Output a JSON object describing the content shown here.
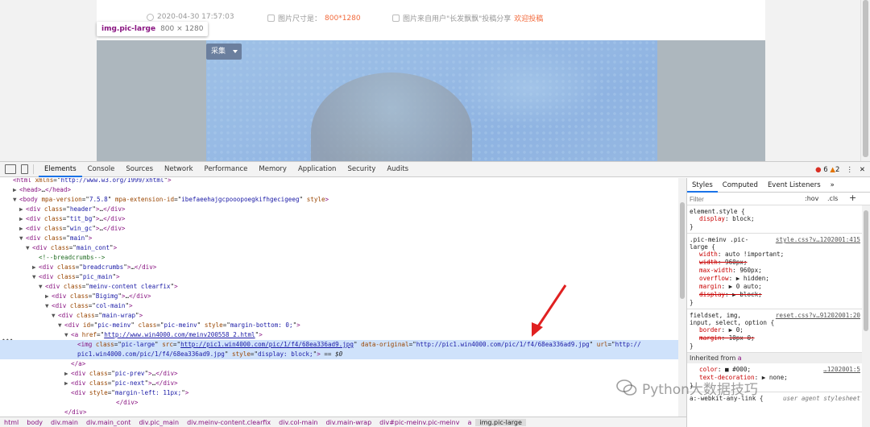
{
  "viewport": {
    "date": "2020-04-30 17:57:03",
    "size_label": "图片尺寸是：",
    "size_value": "800*1280",
    "share_text": "图片来自用户\"长发飘飘\"投稿分享",
    "submit_link": "欢迎投稿",
    "collect_button": "采集",
    "tooltip_tag": "img.pic-large",
    "tooltip_size": "800 × 1280"
  },
  "devtools": {
    "tabs": [
      "Elements",
      "Console",
      "Sources",
      "Network",
      "Performance",
      "Memory",
      "Application",
      "Security",
      "Audits"
    ],
    "active_tab": "Elements",
    "error_count": "6",
    "warning_count": "2",
    "more_tabs": "»",
    "menu": "⋮",
    "close": "✕"
  },
  "dom": [
    {
      "indent": 0,
      "tri": "",
      "html": "<span class='tag'>&lt;html</span> <span class='attr'>xmlns</span>=\"<span class='val'>http://www.w3.org/1999/xhtml</span>\"<span class='tag'>&gt;</span>"
    },
    {
      "indent": 1,
      "tri": "▶",
      "html": "<span class='tag'>&lt;head&gt;</span>…<span class='tag'>&lt;/head&gt;</span>"
    },
    {
      "indent": 1,
      "tri": "▼",
      "html": "<span class='tag'>&lt;body</span> <span class='attr'>mpa-version</span>=\"<span class='val'>7.5.8</span>\" <span class='attr'>mpa-extension-id</span>=\"<span class='val'>ibefaeehajgcpooopoegkifhgecigeeg</span>\" <span class='attr'>style</span><span class='tag'>&gt;</span>"
    },
    {
      "indent": 2,
      "tri": "▶",
      "html": "<span class='tag'>&lt;div</span> <span class='attr'>class</span>=\"<span class='val'>header</span>\"<span class='tag'>&gt;</span>…<span class='tag'>&lt;/div&gt;</span>"
    },
    {
      "indent": 2,
      "tri": "▶",
      "html": "<span class='tag'>&lt;div</span> <span class='attr'>class</span>=\"<span class='val'>tit_bg</span>\"<span class='tag'>&gt;</span>…<span class='tag'>&lt;/div&gt;</span>"
    },
    {
      "indent": 2,
      "tri": "▶",
      "html": "<span class='tag'>&lt;div</span> <span class='attr'>class</span>=\"<span class='val'>win_gc</span>\"<span class='tag'>&gt;</span>…<span class='tag'>&lt;/div&gt;</span>"
    },
    {
      "indent": 2,
      "tri": "▼",
      "html": "<span class='tag'>&lt;div</span> <span class='attr'>class</span>=\"<span class='val'>main</span>\"<span class='tag'>&gt;</span>"
    },
    {
      "indent": 3,
      "tri": "▼",
      "html": "<span class='tag'>&lt;div</span> <span class='attr'>class</span>=\"<span class='val'>main_cont</span>\"<span class='tag'>&gt;</span>"
    },
    {
      "indent": 4,
      "tri": "",
      "html": "<span class='cmt'>&lt;!--breadcrumbs--&gt;</span>"
    },
    {
      "indent": 4,
      "tri": "▶",
      "html": "<span class='tag'>&lt;div</span> <span class='attr'>class</span>=\"<span class='val'>breadcrumbs</span>\"<span class='tag'>&gt;</span>…<span class='tag'>&lt;/div&gt;</span>"
    },
    {
      "indent": 4,
      "tri": "▼",
      "html": "<span class='tag'>&lt;div</span> <span class='attr'>class</span>=\"<span class='val'>pic_main</span>\"<span class='tag'>&gt;</span>"
    },
    {
      "indent": 5,
      "tri": "▼",
      "html": "<span class='tag'>&lt;div</span> <span class='attr'>class</span>=\"<span class='val'>meinv-content clearfix</span>\"<span class='tag'>&gt;</span>"
    },
    {
      "indent": 6,
      "tri": "▶",
      "html": "<span class='tag'>&lt;div</span> <span class='attr'>class</span>=\"<span class='val'>Bigimg</span>\"<span class='tag'>&gt;</span>…<span class='tag'>&lt;/div&gt;</span>"
    },
    {
      "indent": 6,
      "tri": "▼",
      "html": "<span class='tag'>&lt;div</span> <span class='attr'>class</span>=\"<span class='val'>col-main</span>\"<span class='tag'>&gt;</span>"
    },
    {
      "indent": 7,
      "tri": "▼",
      "html": "<span class='tag'>&lt;div</span> <span class='attr'>class</span>=\"<span class='val'>main-wrap</span>\"<span class='tag'>&gt;</span>"
    },
    {
      "indent": 8,
      "tri": "▼",
      "html": "<span class='tag'>&lt;div</span> <span class='attr'>id</span>=\"<span class='val'>pic-meinv</span>\" <span class='attr'>class</span>=\"<span class='val'>pic-meinv</span>\" <span class='attr'>style</span>=\"<span class='val'>margin-bottom: 0;</span>\"<span class='tag'>&gt;</span>"
    },
    {
      "indent": 9,
      "tri": "▼",
      "html": "<span class='tag'>&lt;a</span> <span class='attr'>href</span>=\"<span class='link'>http://www.win4000.com/meinv200558_2.html</span>\"<span class='tag'>&gt;</span>"
    },
    {
      "indent": 10,
      "tri": "",
      "sel": true,
      "html": "<span class='tag'>&lt;img</span> <span class='attr'>class</span>=\"<span class='val'>pic-large</span>\" <span class='attr'>src</span>=\"<span class='link'>http://pic1.win4000.com/pic/1/f4/68ea336ad9.jpg</span>\" <span class='attr'>data-original</span>=\"<span class='val'>http://pic1.win4000.com/pic/1/f4/68ea336ad9.jpg</span>\" <span class='attr'>url</span>=\"<span class='val'>http://</span>"
    },
    {
      "indent": 10,
      "tri": "",
      "sel": true,
      "html": "<span class='val'>pic1.win4000.com/pic/1/f4/68ea336ad9.jpg</span>\" <span class='attr'>style</span>=\"<span class='val'>display: block;</span>\"<span class='tag'>&gt;</span> == <i>$0</i>"
    },
    {
      "indent": 9,
      "tri": "",
      "html": "<span class='tag'>&lt;/a&gt;</span>"
    },
    {
      "indent": 9,
      "tri": "▶",
      "html": "<span class='tag'>&lt;div</span> <span class='attr'>class</span>=\"<span class='val'>pic-prev</span>\"<span class='tag'>&gt;</span>…<span class='tag'>&lt;/div&gt;</span>"
    },
    {
      "indent": 9,
      "tri": "▶",
      "html": "<span class='tag'>&lt;div</span> <span class='attr'>class</span>=\"<span class='val'>pic-next</span>\"<span class='tag'>&gt;</span>…<span class='tag'>&lt;/div&gt;</span>"
    },
    {
      "indent": 9,
      "tri": "",
      "html": "<span class='tag'>&lt;div</span> <span class='attr'>style</span>=\"<span class='val'>margin-left: 11px;</span>\"<span class='tag'>&gt;</span>"
    },
    {
      "indent": 16,
      "tri": "",
      "html": "<span class='tag'>&lt;/div&gt;</span>"
    },
    {
      "indent": 8,
      "tri": "",
      "html": "<span class='tag'>&lt;/div&gt;</span>"
    }
  ],
  "breadcrumbs": [
    "html",
    "body",
    "div.main",
    "div.main_cont",
    "div.pic_main",
    "div.meinv-content.clearfix",
    "div.col-main",
    "div.main-wrap",
    "div#pic-meinv.pic-meinv",
    "a",
    "img.pic-large"
  ],
  "styles": {
    "tabs": [
      "Styles",
      "Computed",
      "Event Listeners",
      "»"
    ],
    "filter_placeholder": "Filter",
    "hov": ":hov",
    "cls": ".cls",
    "plus": "+",
    "element_style": {
      "selector": "element.style {",
      "props": [
        {
          "n": "display",
          "v": "block;"
        }
      ]
    },
    "rule1": {
      "selector1": ".pic-meinv .pic-",
      "selector2": "large {",
      "source": "style.css?v…1202001:415",
      "props": [
        {
          "n": "width",
          "v": "auto !important;",
          "strike": false
        },
        {
          "n": "width",
          "v": "960px;",
          "strike": true
        },
        {
          "n": "max-width",
          "v": "960px;",
          "strike": false
        },
        {
          "n": "overflow",
          "v": "▶ hidden;",
          "strike": false
        },
        {
          "n": "margin",
          "v": "▶ 0 auto;",
          "strike": false
        },
        {
          "n": "display",
          "v": "▶ block;",
          "strike": true
        }
      ]
    },
    "rule2": {
      "selector1": "fieldset, img,",
      "selector2": "input, select, option {",
      "source": "reset.css?v…91202001:20",
      "props": [
        {
          "n": "border",
          "v": "▶ 0;",
          "strike": false
        },
        {
          "n": "margin",
          "v": "10px 0;",
          "strike": true
        }
      ]
    },
    "inherited_label": "Inherited from",
    "inherited_tag": "a",
    "rule3": {
      "source": "…1202001:5",
      "props": [
        {
          "n": "color",
          "v": "■ #000;"
        },
        {
          "n": "text-decoration",
          "v": "▶ none;"
        }
      ]
    },
    "closing": "}",
    "ua_selector": "a:-webkit-any-link {",
    "ua_source": "user agent stylesheet"
  },
  "watermark": "Python大数据技巧"
}
